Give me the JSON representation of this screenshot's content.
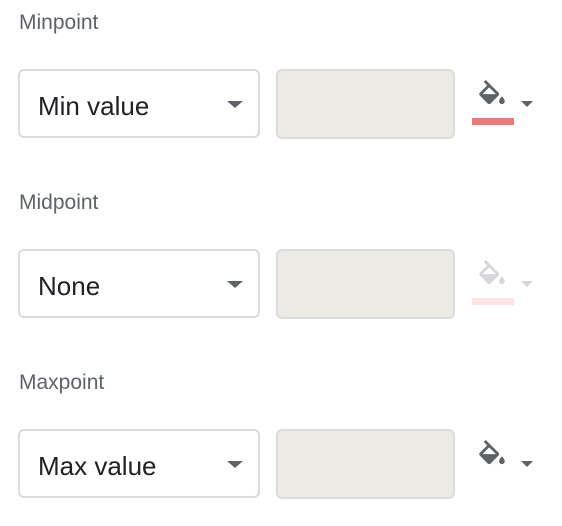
{
  "minpoint": {
    "label": "Minpoint",
    "type_value": "Min value",
    "value": "",
    "color": "#e67c73",
    "icon": "paint-bucket-icon",
    "disabled_color_picker": false
  },
  "midpoint": {
    "label": "Midpoint",
    "type_value": "None",
    "value": "",
    "color": "#fbe4e2",
    "icon": "paint-bucket-icon",
    "disabled_color_picker": true
  },
  "maxpoint": {
    "label": "Maxpoint",
    "type_value": "Max value",
    "value": "",
    "color": "#ffffff",
    "icon": "paint-bucket-icon",
    "disabled_color_picker": false
  },
  "colors": {
    "icon_active": "#5f6368",
    "icon_disabled": "#d5d7da",
    "input_disabled_bg": "#ebebe4",
    "border": "#dadce0"
  }
}
